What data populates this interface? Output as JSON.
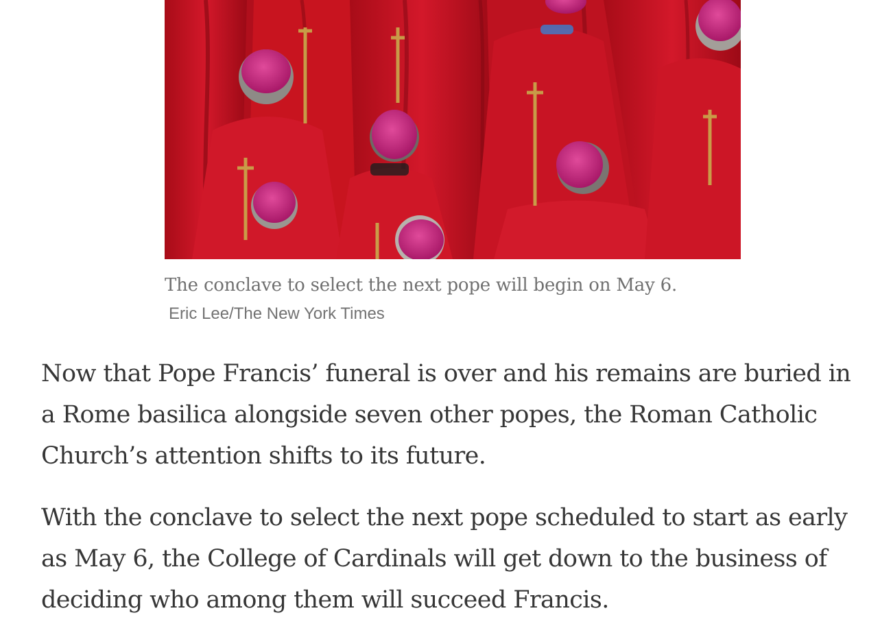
{
  "figure": {
    "image_alt": "Cardinals in red vestments and magenta skullcaps, seen from behind",
    "caption": "The conclave to select the next pope will begin on May 6.",
    "credit": "Eric Lee/The New York Times"
  },
  "article": {
    "paragraphs": [
      "Now that Pope Francis’ funeral is over and his remains are buried in a Rome basilica alongside seven other popes, the Roman Catholic Church’s attention shifts to its future.",
      "With the conclave to select the next pope scheduled to start as early as May 6, the College of Cardinals will get down to the business of deciding who among them will succeed Francis."
    ]
  },
  "colors": {
    "vestment_red": "#c8141f",
    "skullcap_magenta": "#c8247e",
    "embroidery_gold": "#c9a34a"
  }
}
